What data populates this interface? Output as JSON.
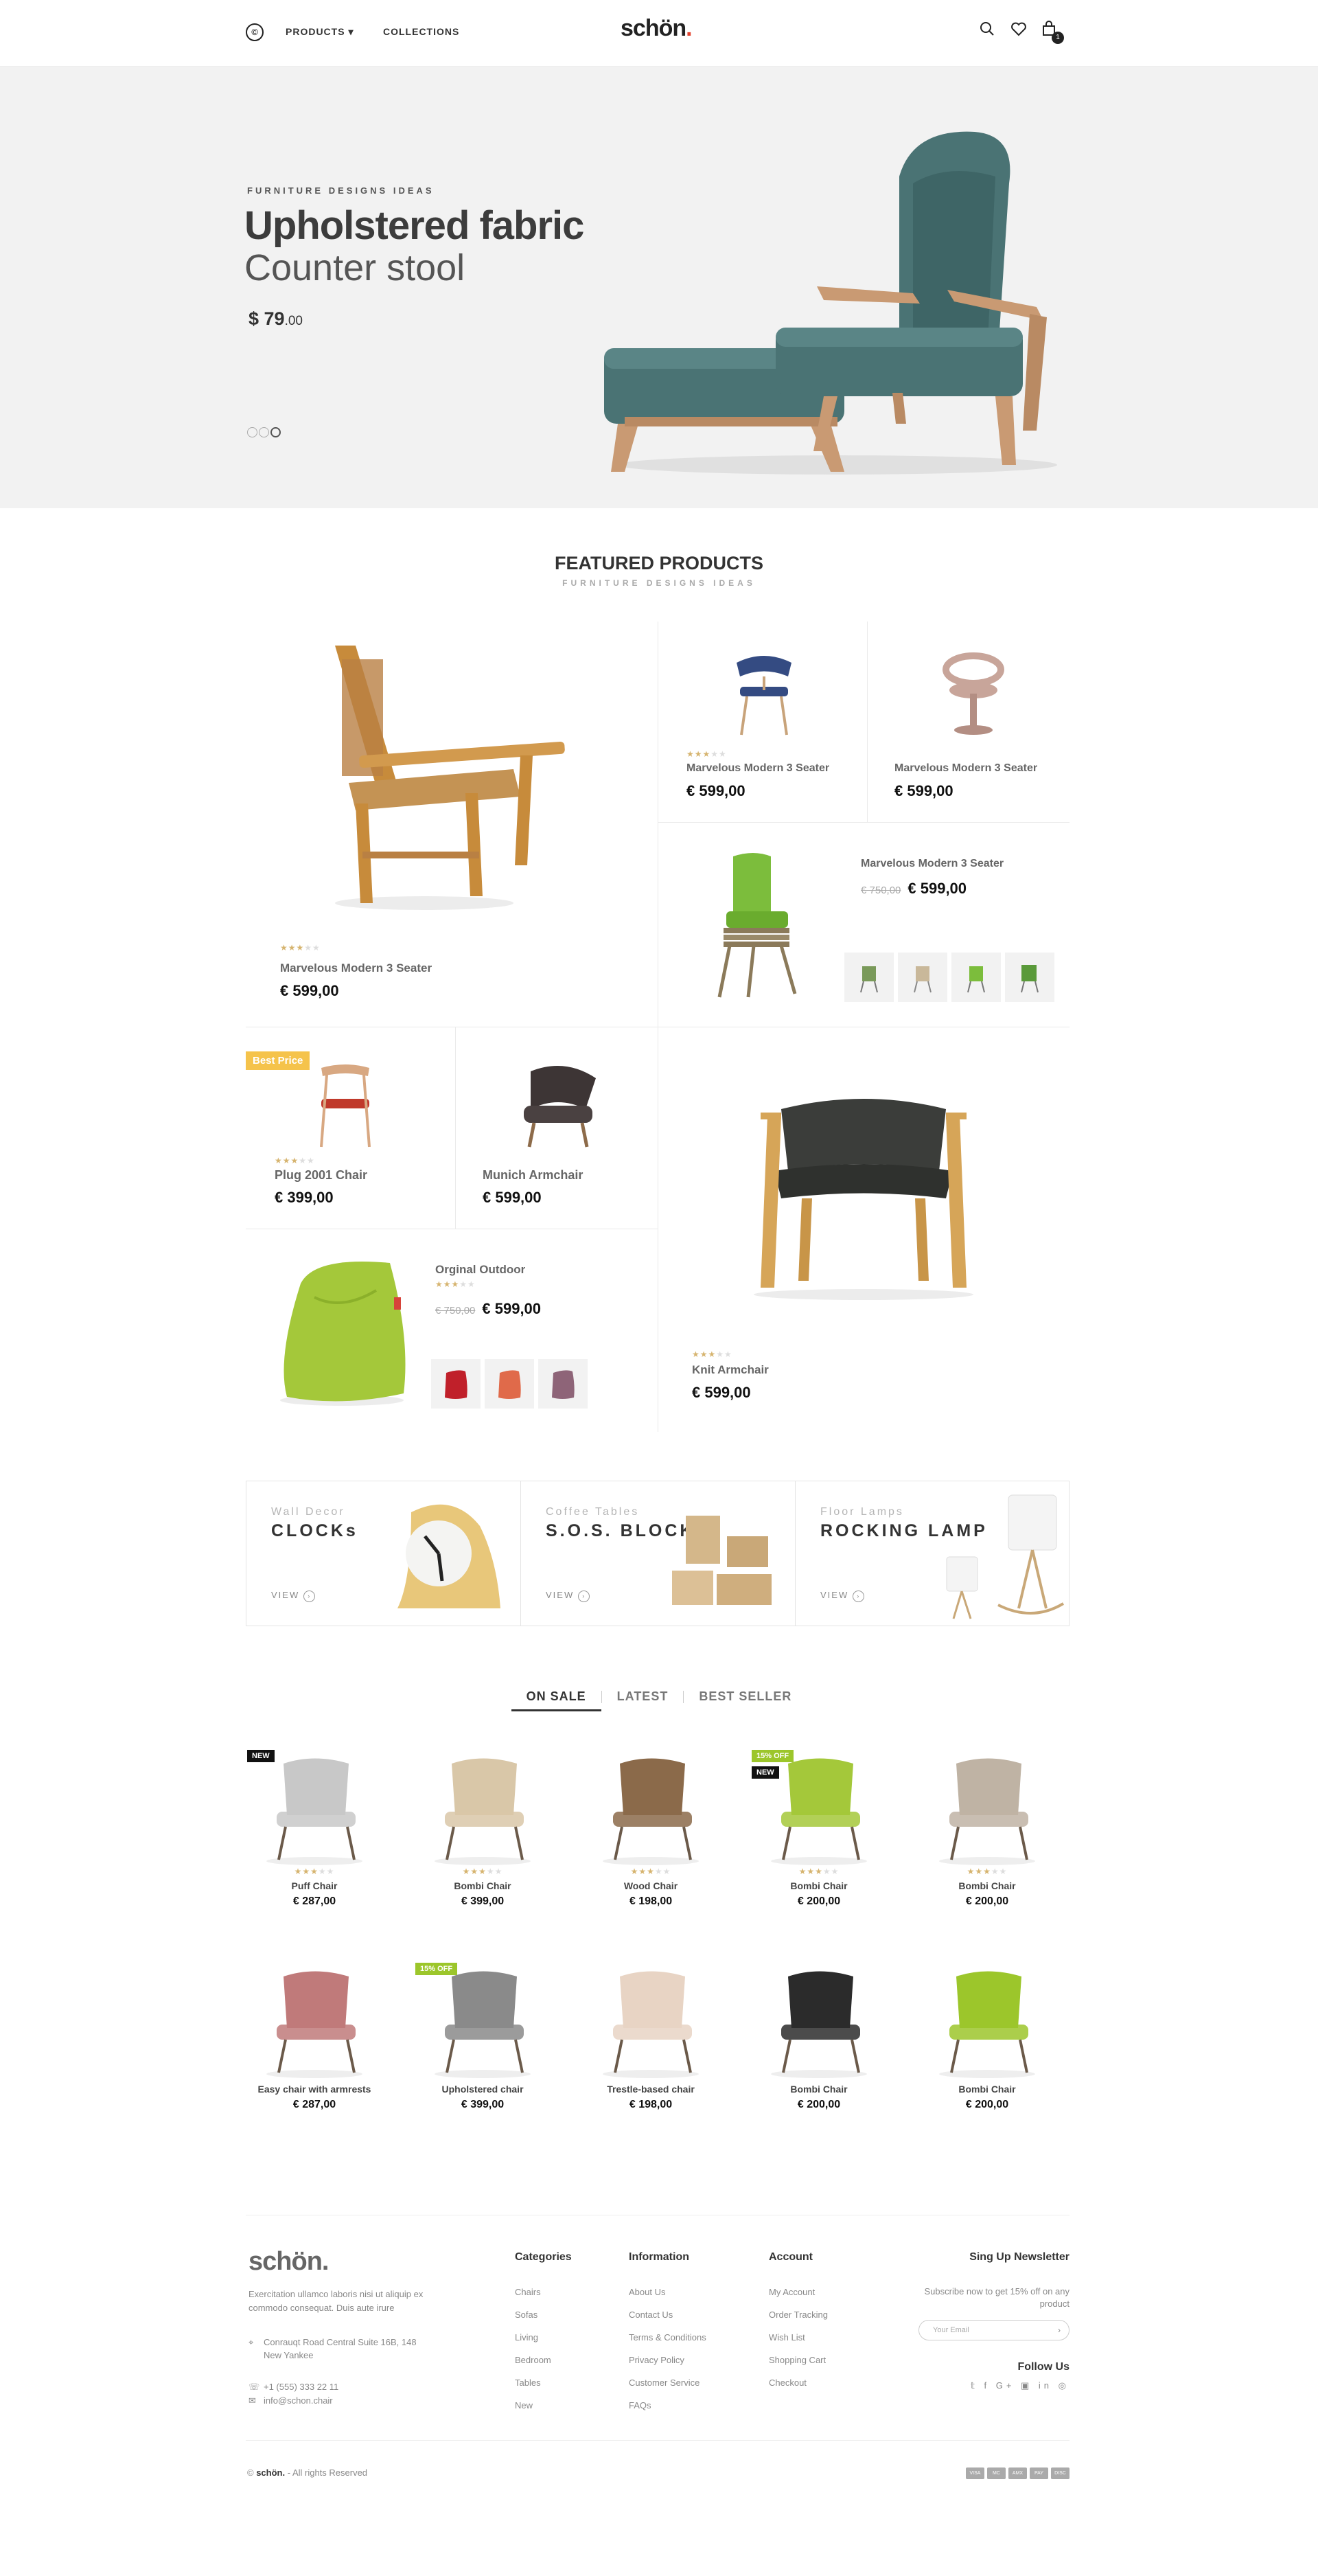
{
  "header": {
    "logo_icon_label": "©",
    "nav_products": "PRODUCTS ▾",
    "nav_collections": "COLLECTIONS",
    "logo": "schön",
    "logo_dot": ".",
    "cart_count": "1"
  },
  "hero": {
    "kicker": "FURNITURE DESIGNS IDEAS",
    "title": "Upholstered fabric",
    "subtitle": "Counter stool",
    "price_main": "$ 79",
    "price_cents": ".00"
  },
  "featured": {
    "title": "FEATURED PRODUCTS",
    "subtitle": "FURNITURE DESIGNS IDEAS",
    "items": [
      {
        "name": "Marvelous Modern 3 Seater",
        "price": "€ 599,00"
      },
      {
        "name": "Marvelous Modern 3 Seater",
        "price": "€ 599,00"
      },
      {
        "name": "Marvelous Modern 3 Seater",
        "price": "€ 599,00"
      },
      {
        "name": "Marvelous Modern 3 Seater",
        "price": "€ 599,00",
        "old_price": "€ 750,00"
      },
      {
        "name": "Plug 2001 Chair",
        "price": "€ 399,00",
        "badge": "Best Price"
      },
      {
        "name": "Munich Armchair",
        "price": "€ 599,00"
      },
      {
        "name": "Orginal Outdoor",
        "price": "€ 599,00",
        "old_price": "€ 750,00"
      },
      {
        "name": "Knit Armchair",
        "price": "€ 599,00"
      }
    ]
  },
  "categories": [
    {
      "kicker": "Wall Decor",
      "title": "CLOCKs",
      "view": "VIEW"
    },
    {
      "kicker": "Coffee Tables",
      "title": "S.O.S. BLOCKS",
      "view": "VIEW"
    },
    {
      "kicker": "Floor Lamps",
      "title": "ROCKING LAMP",
      "view": "VIEW"
    }
  ],
  "tabs": [
    "ON SALE",
    "LATEST",
    "BEST SELLER"
  ],
  "products": [
    {
      "name": "Puff Chair",
      "price": "€ 287,00",
      "tag1": "NEW"
    },
    {
      "name": "Bombi Chair",
      "price": "€ 399,00"
    },
    {
      "name": "Wood Chair",
      "price": "€ 198,00"
    },
    {
      "name": "Bombi Chair",
      "price": "€ 200,00",
      "tag1": "15% OFF",
      "tag2": "NEW"
    },
    {
      "name": "Bombi Chair",
      "price": "€ 200,00"
    },
    {
      "name": "Easy chair with armrests",
      "price": "€ 287,00"
    },
    {
      "name": "Upholstered chair",
      "price": "€ 399,00",
      "tag1": "15% OFF"
    },
    {
      "name": "Trestle-based chair",
      "price": "€ 198,00"
    },
    {
      "name": "Bombi Chair",
      "price": "€ 200,00"
    },
    {
      "name": "Bombi Chair",
      "price": "€ 200,00"
    }
  ],
  "footer": {
    "logo": "schön.",
    "desc": "Exercitation ullamco laboris nisi ut aliquip ex commodo consequat. Duis aute irure",
    "address": "Conrauqt Road Central Suite 16B, 148 New Yankee",
    "phone": "+1 (555) 333 22 11",
    "email": "info@schon.chair",
    "col1_title": "Categories",
    "col1": [
      "Chairs",
      "Sofas",
      "Living",
      "Bedroom",
      "Tables",
      "New"
    ],
    "col2_title": "Information",
    "col2": [
      "About Us",
      "Contact Us",
      "Terms & Conditions",
      "Privacy Policy",
      "Customer Service",
      "FAQs"
    ],
    "col3_title": "Account",
    "col3": [
      "My Account",
      "Order Tracking",
      "Wish List",
      "Shopping Cart",
      "Checkout"
    ],
    "newsletter_title": "Sing Up Newsletter",
    "newsletter_text": "Subscribe now to get 15% off on any product",
    "email_placeholder": "Your Email",
    "follow": "Follow Us",
    "social": "𝕥 f G+ ▣ in ◎",
    "copyright_brand": "schön.",
    "copyright_rest": " - All rights Reserved",
    "cards": [
      "VISA",
      "MC",
      "AMX",
      "PAY",
      "DISC"
    ]
  },
  "colors": {
    "accent": "#e2432f",
    "star": "#d6b46f",
    "badge": "#f5c34b",
    "sale_tag": "#9cc62b"
  }
}
